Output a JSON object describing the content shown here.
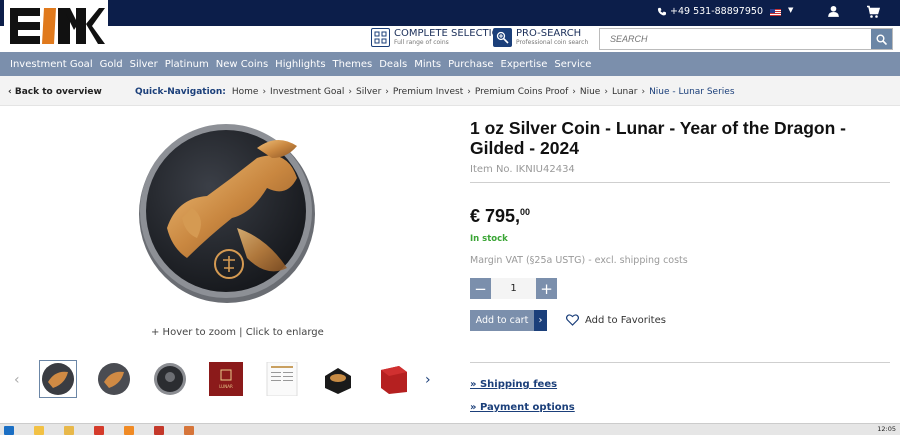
{
  "brand": {
    "logo_text": "EMK"
  },
  "topbar": {
    "phone": "+49 531-88897950"
  },
  "header": {
    "complete_selection": {
      "title": "COMPLETE SELECTION",
      "sub": "Full range of coins"
    },
    "pro_search": {
      "title": "PRO-SEARCH",
      "sub": "Professional coin search"
    },
    "search_placeholder": "SEARCH"
  },
  "nav": [
    "Investment Goal",
    "Gold",
    "Silver",
    "Platinum",
    "New Coins",
    "Highlights",
    "Themes",
    "Deals",
    "Mints",
    "Purchase",
    "Expertise",
    "Service"
  ],
  "breadcrumbs": {
    "back": "Back to overview",
    "label": "Quick-Navigation:",
    "items": [
      "Home",
      "Investment Goal",
      "Silver",
      "Premium Invest",
      "Premium Coins Proof",
      "Niue",
      "Lunar"
    ],
    "current": "Niue - Lunar Series"
  },
  "gallery": {
    "hover_text": "+ Hover to zoom | Click to enlarge"
  },
  "product": {
    "title": "1 oz Silver Coin - Lunar - Year of the Dragon - Gilded - 2024",
    "item_no": "Item No. IKNIU42434",
    "price_main": "€ 795,",
    "price_cents": "00",
    "stock": "In stock",
    "vat": "Margin VAT (§25a USTG)  -  excl. shipping costs",
    "quantity": "1",
    "add_to_cart": "Add to cart",
    "add_to_favorites": "Add to Favorites",
    "shipping_fees": "» Shipping fees",
    "payment_options": "» Payment options"
  },
  "taskbar": {
    "clock": "12:05"
  },
  "colors": {
    "navy": "#0c1e4a",
    "nav_bg": "#7b8fac",
    "accent": "#1b3f7a",
    "stock": "#3aa535",
    "gold": "#d99a4e"
  }
}
